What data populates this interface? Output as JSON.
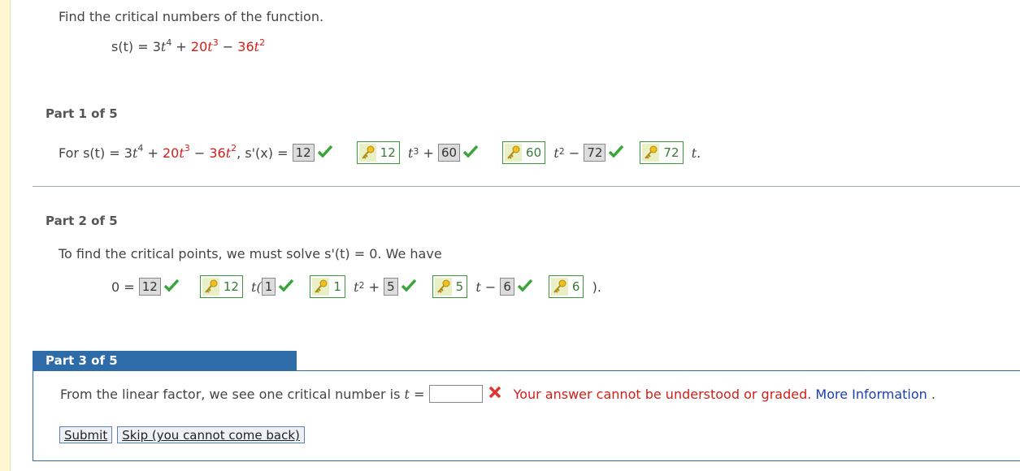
{
  "question": {
    "prompt": "Find the critical numbers of the function.",
    "function": {
      "lhs": "s(t)",
      "eq": "=",
      "c1": "3",
      "c2": "20",
      "c3": "36",
      "var": "t",
      "exp4": "4",
      "exp3": "3",
      "exp2": "2",
      "plus": "+",
      "minus": "−"
    }
  },
  "part1": {
    "label": "Part 1 of 5",
    "lead": "For s(t)",
    "deriv": "s'(x)",
    "answers": [
      "12",
      "12",
      "60",
      "60",
      "72",
      "72"
    ],
    "tail": "t."
  },
  "part2": {
    "label": "Part 2 of 5",
    "sentence_a": "To find the critical points, we must solve",
    "sentence_b": "s'(t)",
    "sentence_c": "= 0.",
    "sentence_d": "We have",
    "zero": "0",
    "answers": [
      "12",
      "12",
      "1",
      "1",
      "5",
      "5",
      "6",
      "6"
    ],
    "t_open": "t(",
    "close": ")."
  },
  "part3": {
    "label": "Part 3 of 5",
    "prompt": "From the linear factor, we see one critical number is",
    "var": "t",
    "eq": "=",
    "input_value": "",
    "error": "Your answer cannot be understood or graded.",
    "more_info": "More Information",
    "period": ".",
    "submit": "Submit",
    "skip": "Skip (you cannot come back)"
  }
}
